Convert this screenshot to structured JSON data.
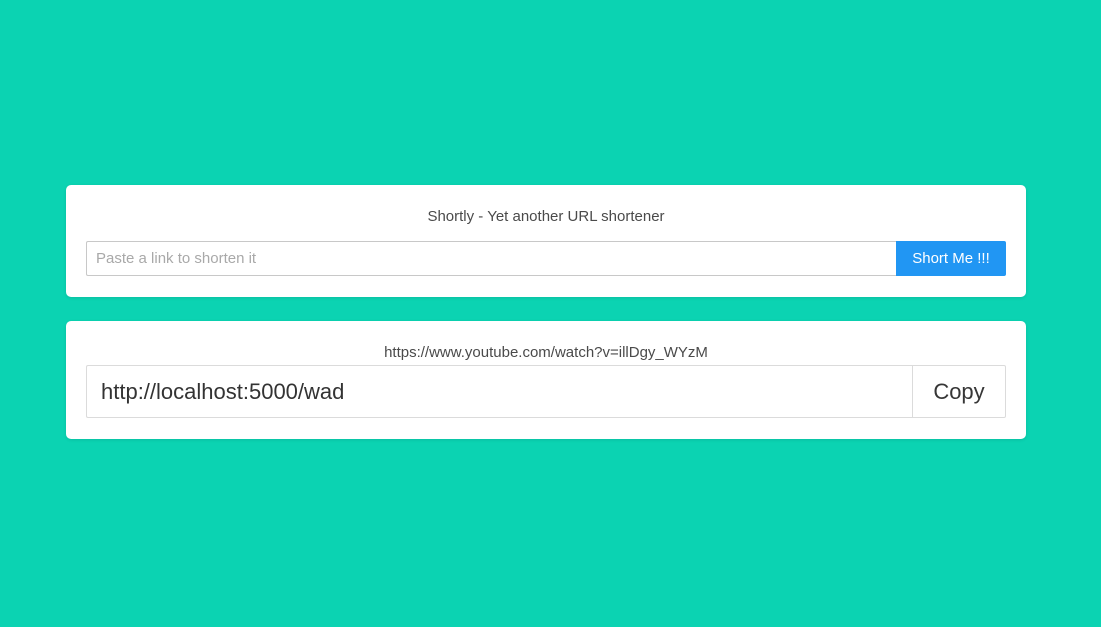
{
  "theme": {
    "background": "#0bd3b2",
    "accent": "#2196f3"
  },
  "shortener": {
    "title": "Shortly - Yet another URL shortener",
    "input_placeholder": "Paste a link to shorten it",
    "input_value": "",
    "submit_label": "Short Me !!!"
  },
  "result": {
    "original_url": "https://www.youtube.com/watch?v=illDgy_WYzM",
    "short_url": "http://localhost:5000/wad",
    "copy_label": "Copy"
  }
}
